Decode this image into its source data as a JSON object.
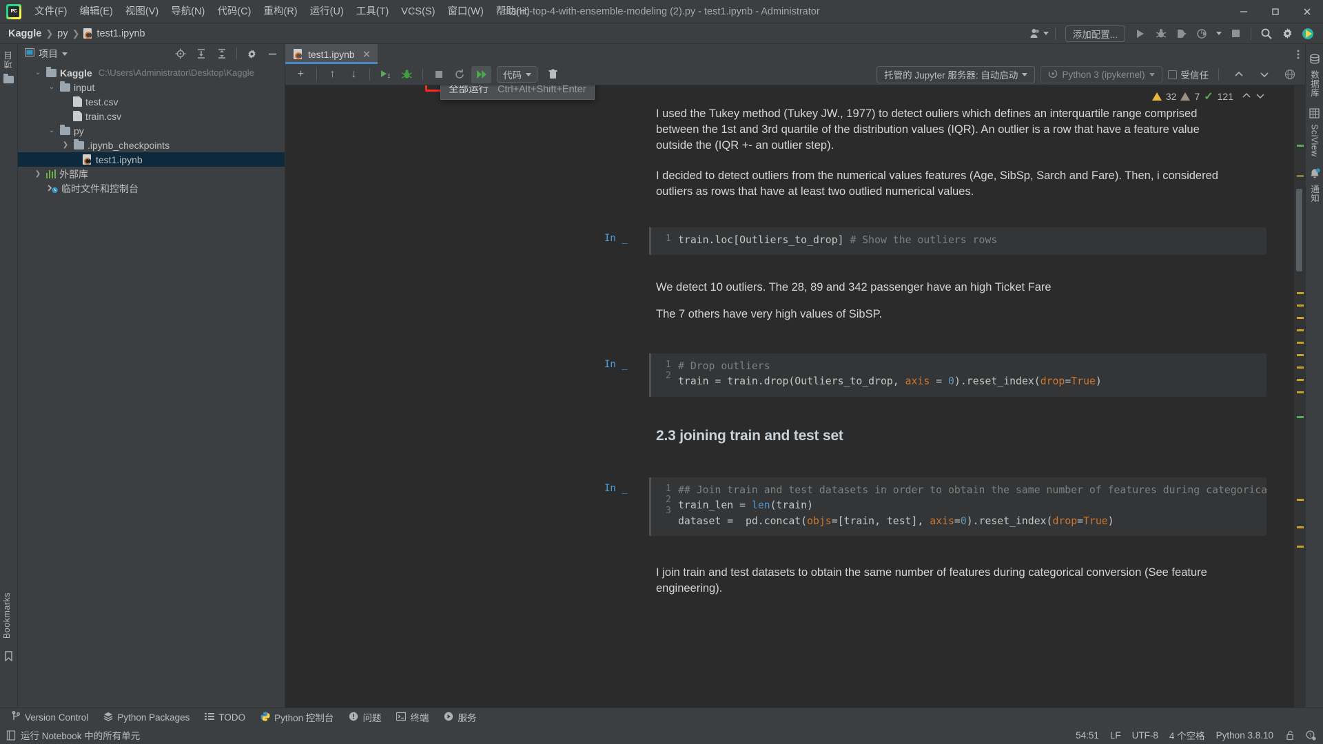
{
  "titlebar": {
    "logo": "pycharm-logo",
    "window_title": "titanic-top-4-with-ensemble-modeling (2).py - test1.ipynb - Administrator",
    "menus": [
      {
        "label": "文件(F)"
      },
      {
        "label": "编辑(E)"
      },
      {
        "label": "视图(V)"
      },
      {
        "label": "导航(N)"
      },
      {
        "label": "代码(C)"
      },
      {
        "label": "重构(R)"
      },
      {
        "label": "运行(U)"
      },
      {
        "label": "工具(T)"
      },
      {
        "label": "VCS(S)"
      },
      {
        "label": "窗口(W)"
      },
      {
        "label": "帮助(H)"
      }
    ],
    "minimize": "—",
    "maximize": "▢",
    "close": "✕"
  },
  "navbar": {
    "crumbs": [
      {
        "label": "Kaggle"
      },
      {
        "label": "py"
      },
      {
        "label": "test1.ipynb"
      }
    ],
    "separator": "❯",
    "add_config_label": "添加配置...",
    "icons": [
      "user-dropdown-icon",
      "run-icon",
      "debug-icon",
      "run-coverage-icon",
      "profile-icon",
      "stop-icon",
      "search-icon",
      "settings-icon",
      "ide-assistant-icon"
    ]
  },
  "left_strip": {
    "project_label": "项目",
    "bookmarks_label": "Bookmarks"
  },
  "project_panel": {
    "title": "项目",
    "header_icons": [
      "locate-icon",
      "expand-all-icon",
      "collapse-all-icon",
      "settings-icon",
      "hide-icon"
    ],
    "tree": [
      {
        "label": "Kaggle",
        "path": "C:\\Users\\Administrator\\Desktop\\Kaggle",
        "type": "folder-root",
        "depth": 0,
        "expanded": true,
        "selected": false
      },
      {
        "label": "input",
        "path": "",
        "type": "folder",
        "depth": 1,
        "expanded": true,
        "selected": false
      },
      {
        "label": "test.csv",
        "path": "",
        "type": "file-csv",
        "depth": 2,
        "expanded": null,
        "selected": false
      },
      {
        "label": "train.csv",
        "path": "",
        "type": "file-csv",
        "depth": 2,
        "expanded": null,
        "selected": false
      },
      {
        "label": "py",
        "path": "",
        "type": "folder",
        "depth": 1,
        "expanded": true,
        "selected": false
      },
      {
        "label": ".ipynb_checkpoints",
        "path": "",
        "type": "folder",
        "depth": 2,
        "expanded": false,
        "selected": false
      },
      {
        "label": "test1.ipynb",
        "path": "",
        "type": "file-notebook",
        "depth": 3,
        "expanded": null,
        "selected": true
      },
      {
        "label": "外部库",
        "path": "",
        "type": "library",
        "depth": 0,
        "expanded": false,
        "selected": false
      },
      {
        "label": "临时文件和控制台",
        "path": "",
        "type": "scratches",
        "depth": 0,
        "expanded": null,
        "selected": false
      }
    ]
  },
  "editor": {
    "tab": {
      "label": "test1.ipynb",
      "close": "✕"
    },
    "notebook_toolbar": {
      "add_cell": "+",
      "move_up": "↑",
      "move_down": "↓",
      "run_cell": "▶",
      "debug_cell": "debug-icon",
      "interrupt": "■",
      "restart": "restart-icon",
      "run_all": "run-all-icon",
      "cell_type": "代码",
      "delete_cell": "trash-icon",
      "jupyter_server": "托管的 Jupyter 服务器: 自动启动",
      "kernel": "Python 3 (ipykernel)",
      "trusted": "受信任",
      "nav_up": "⌃",
      "nav_down": "⌄",
      "globe": "globe-icon"
    },
    "tooltip": {
      "label": "全部运行",
      "shortcut": "Ctrl+Alt+Shift+Enter"
    },
    "inspections": {
      "warnings": "32",
      "weak_warnings": "7",
      "checks": "121",
      "prev": "⌃",
      "next": "⌄"
    },
    "cells": [
      {
        "type": "markdown",
        "paragraphs": [
          "I used the Tukey method (Tukey JW., 1977) to detect ouliers which defines an interquartile range comprised between the 1st and 3rd quartile of the distribution values (IQR). An outlier is a row that have a feature value outside the (IQR +- an outlier step).",
          "I decided to detect outliers from the numerical values features (Age, SibSp, Sarch and Fare). Then, i considered outliers as rows that have at least two outlied numerical values."
        ]
      },
      {
        "type": "code",
        "prompt": "In",
        "exec_count": "_",
        "lines": [
          "train.loc[Outliers_to_drop] # Show the outliers rows"
        ]
      },
      {
        "type": "markdown",
        "paragraphs": [
          "We detect 10 outliers. The 28, 89 and 342 passenger have an high Ticket Fare",
          "The 7 others have very high values of SibSP."
        ]
      },
      {
        "type": "code",
        "prompt": "In",
        "exec_count": "_",
        "lines": [
          "# Drop outliers",
          "train = train.drop(Outliers_to_drop, axis = 0).reset_index(drop=True)"
        ]
      },
      {
        "type": "heading",
        "text": "2.3 joining train and test set"
      },
      {
        "type": "code",
        "prompt": "In",
        "exec_count": "_",
        "lines": [
          "## Join train and test datasets in order to obtain the same number of features during categorical conversion",
          "train_len = len(train)",
          "dataset =  pd.concat(objs=[train, test], axis=0).reset_index(drop=True)"
        ]
      },
      {
        "type": "markdown",
        "paragraphs": [
          "I join train and test datasets to obtain the same number of features during categorical conversion (See feature engineering)."
        ]
      }
    ]
  },
  "right_strip": {
    "items": [
      {
        "label": "数据库",
        "icon": "database-icon"
      },
      {
        "label": "SciView",
        "icon": "sciview-icon"
      },
      {
        "label": "通知",
        "icon": "bell-icon"
      }
    ]
  },
  "bottom_bar": {
    "items": [
      {
        "label": "Version Control",
        "icon": "branch-icon"
      },
      {
        "label": "Python Packages",
        "icon": "packages-icon"
      },
      {
        "label": "TODO",
        "icon": "todo-icon"
      },
      {
        "label": "Python 控制台",
        "icon": "python-icon"
      },
      {
        "label": "问题",
        "icon": "problems-icon"
      },
      {
        "label": "终端",
        "icon": "terminal-icon"
      },
      {
        "label": "服务",
        "icon": "services-icon"
      }
    ]
  },
  "status_bar": {
    "message": "运行 Notebook 中的所有单元",
    "message_icon": "notebook-icon",
    "caret_position": "54:51",
    "line_separator": "LF",
    "encoding": "UTF-8",
    "indent": "4 个空格",
    "interpreter": "Python 3.8.10",
    "lock_icon": "unlock-icon",
    "inspection_icon": "inspection-level-icon"
  },
  "colors": {
    "accent_blue": "#4a88c7",
    "selection": "#0d293e",
    "red_highlight": "#ff2a1f",
    "green_run": "#5ba85b",
    "warning_yellow": "#e8b63a",
    "panel_bg": "#3c3f41",
    "editor_bg": "#2b2b2b",
    "cell_bg": "#333537"
  }
}
